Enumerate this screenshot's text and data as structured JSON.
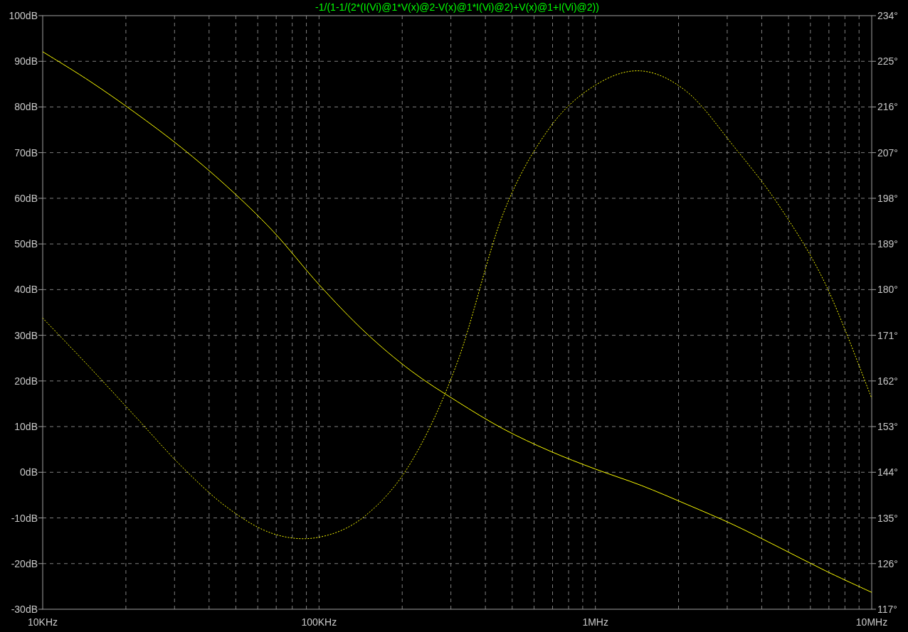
{
  "plot": {
    "chart_data": {
      "type": "line",
      "title": "-1/(1-1/(2*(I(Vi)@1*V(x)@2-V(x)@1*I(Vi)@2)+V(x)@1+I(Vi)@2))",
      "categories": [
        "10KHz",
        null,
        null,
        null,
        null,
        null,
        "100KHz",
        null,
        null,
        null,
        null,
        null,
        "1MHz",
        null,
        null,
        null,
        null,
        null,
        "10MHz"
      ],
      "grid": true,
      "ylim": [
        -30,
        100
      ],
      "yticks": [
        {
          "value": 100,
          "label": "100dB"
        },
        {
          "value": 90,
          "label": "90dB"
        },
        {
          "value": 80,
          "label": "80dB"
        },
        {
          "value": 70,
          "label": "70dB"
        },
        {
          "value": 60,
          "label": "60dB"
        },
        {
          "value": 50,
          "label": "50dB"
        },
        {
          "value": 40,
          "label": "40dB"
        },
        {
          "value": 30,
          "label": "30dB"
        },
        {
          "value": 20,
          "label": "20dB"
        },
        {
          "value": 10,
          "label": "10dB"
        },
        {
          "value": 0,
          "label": "0dB"
        },
        {
          "value": -10,
          "label": "-10dB"
        },
        {
          "value": -20,
          "label": "-20dB"
        },
        {
          "value": -30,
          "label": "-30dB"
        }
      ],
      "y2lim": [
        117,
        234
      ],
      "y2ticks": [
        {
          "value": 234,
          "label": "234°"
        },
        {
          "value": 225,
          "label": "225°"
        },
        {
          "value": 216,
          "label": "216°"
        },
        {
          "value": 207,
          "label": "207°"
        },
        {
          "value": 198,
          "label": "198°"
        },
        {
          "value": 189,
          "label": "189°"
        },
        {
          "value": 180,
          "label": "180°"
        },
        {
          "value": 171,
          "label": "171°"
        },
        {
          "value": 162,
          "label": "162°"
        },
        {
          "value": 153,
          "label": "153°"
        },
        {
          "value": 144,
          "label": "144°"
        },
        {
          "value": 135,
          "label": "135°"
        },
        {
          "value": 126,
          "label": "126°"
        },
        {
          "value": 117,
          "label": "117°"
        }
      ],
      "series": [
        {
          "color": "#ffff00",
          "values": [
            92.1,
            85.8,
            78.8,
            71.2,
            62.6,
            52.8,
            41.1,
            30.7,
            22.2,
            15.5,
            9.5,
            4.7,
            0.7,
            -2.9,
            -7.1,
            -11.5,
            -16.5,
            -21.6,
            -26.3
          ]
        },
        {
          "color": "#ffff00",
          "axis": "y2",
          "line_style": "dashed",
          "values": [
            174.4,
            164.9,
            155.1,
            145.3,
            137.1,
            131.9,
            131.2,
            135.4,
            146,
            165.6,
            195,
            211.8,
            220.3,
            223.1,
            218.9,
            208.3,
            196.4,
            181,
            158.6
          ]
        }
      ]
    }
  }
}
